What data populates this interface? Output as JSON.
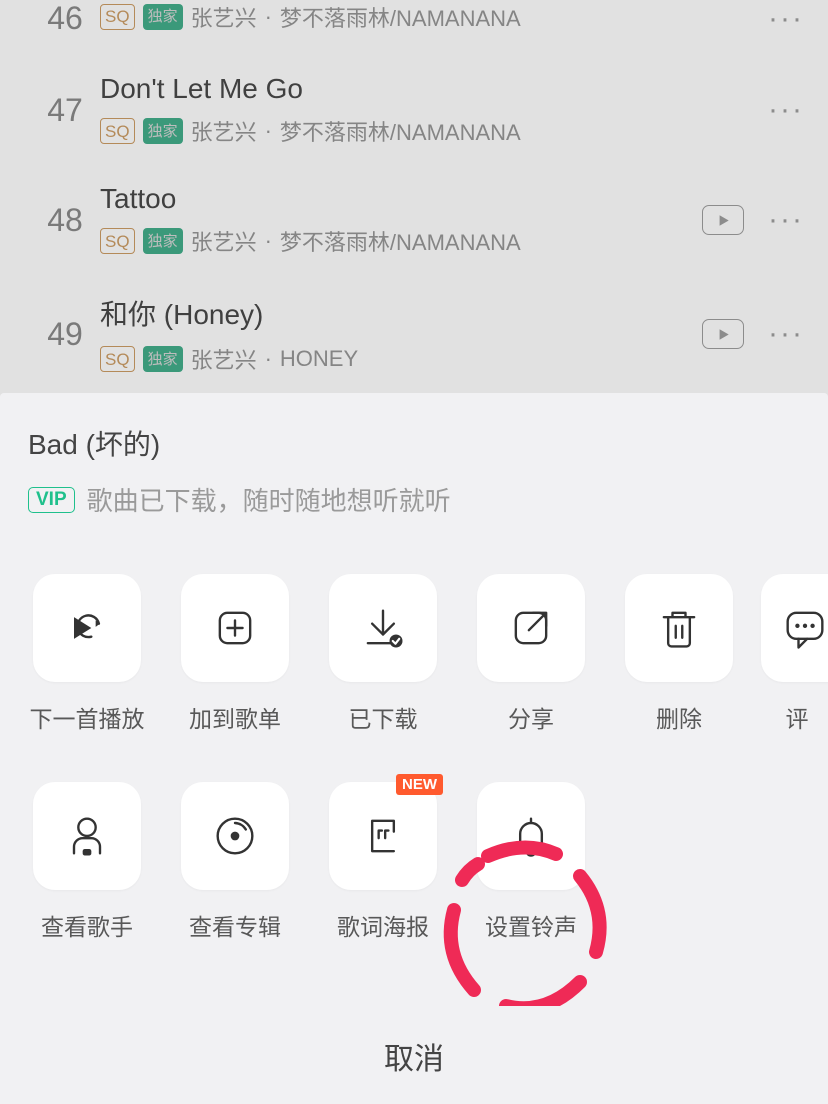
{
  "list": {
    "songs": [
      {
        "index": "46",
        "title": "",
        "sq": "SQ",
        "ex": "独家",
        "artist": "张艺兴",
        "sep": "·",
        "album": "梦不落雨林/NAMANANA",
        "hasMV": false
      },
      {
        "index": "47",
        "title": "Don't Let Me Go",
        "sq": "SQ",
        "ex": "独家",
        "artist": "张艺兴",
        "sep": "·",
        "album": "梦不落雨林/NAMANANA",
        "hasMV": false
      },
      {
        "index": "48",
        "title": "Tattoo",
        "sq": "SQ",
        "ex": "独家",
        "artist": "张艺兴",
        "sep": "·",
        "album": "梦不落雨林/NAMANANA",
        "hasMV": true
      },
      {
        "index": "49",
        "title": "和你 (Honey)",
        "sq": "SQ",
        "ex": "独家",
        "artist": "张艺兴",
        "sep": "·",
        "album": "HONEY",
        "hasMV": true
      }
    ],
    "dots": "···"
  },
  "sheet": {
    "title": "Bad (坏的)",
    "vip": "VIP",
    "subtitle": "歌曲已下载，随时随地想听就听",
    "row1": [
      {
        "key": "play-next",
        "label": "下一首播放"
      },
      {
        "key": "add-playlist",
        "label": "加到歌单"
      },
      {
        "key": "downloaded",
        "label": "已下载"
      },
      {
        "key": "share",
        "label": "分享"
      },
      {
        "key": "delete",
        "label": "删除"
      },
      {
        "key": "comment",
        "label": "评"
      }
    ],
    "row2": [
      {
        "key": "artist",
        "label": "查看歌手"
      },
      {
        "key": "album",
        "label": "查看专辑"
      },
      {
        "key": "lyric-poster",
        "label": "歌词海报",
        "new": "NEW"
      },
      {
        "key": "ringtone",
        "label": "设置铃声",
        "highlighted": true
      }
    ],
    "cancel": "取消"
  }
}
